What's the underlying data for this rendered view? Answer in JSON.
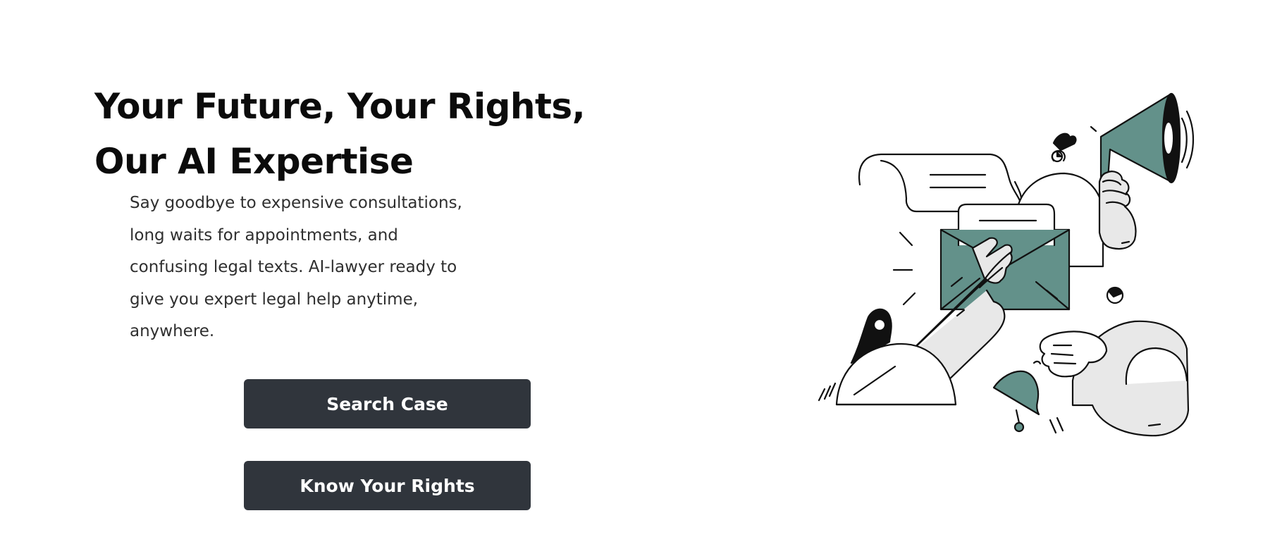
{
  "hero": {
    "title_line1": "Your Future, Your Rights,",
    "title_line2": "Our AI Expertise",
    "description_lines": [
      "Say goodbye to expensive consultations,",
      "long waits for appointments, and",
      "confusing legal texts. AI-lawyer ready to",
      "give you expert legal help anytime,",
      "anywhere."
    ]
  },
  "buttons": {
    "search_case": "Search Case",
    "know_your_rights": "Know Your Rights"
  },
  "colors": {
    "button_bg": "#30353c",
    "accent_teal": "#63918a",
    "illustration_fill": "#e8e8e8"
  },
  "illustration": {
    "icons": [
      "envelope-icon",
      "pointing-hand-icon",
      "megaphone-icon",
      "hand-holding-megaphone-icon",
      "bell-icon",
      "scroll-letter-icon",
      "heart-icon",
      "location-pin-icon"
    ]
  }
}
